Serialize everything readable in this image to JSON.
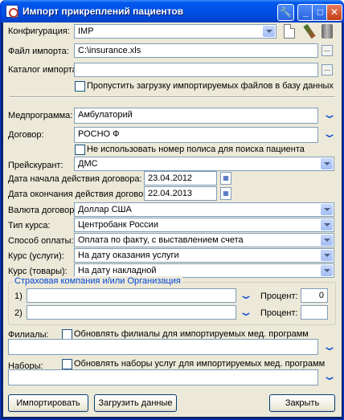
{
  "window": {
    "title": "Импорт прикреплений пациентов",
    "buttons": {
      "tools": "🔧",
      "minimize": "_",
      "maximize": "□",
      "close": "✕"
    }
  },
  "config": {
    "label": "Конфигурация:",
    "value": "IMP"
  },
  "import_file": {
    "label": "Файл импорта:",
    "value": "C:\\insurance.xls",
    "browse": "..."
  },
  "import_dir": {
    "label": "Каталог импорта:",
    "value": "",
    "browse": "..."
  },
  "skip_upload": {
    "label": "Пропустить загрузку импортируемых файлов в базу данных",
    "checked": false
  },
  "medprogram": {
    "label": "Медпрограмма:",
    "value": "Амбулаторий"
  },
  "contract": {
    "label": "Договор:",
    "value": "РОСНО Ф"
  },
  "no_policy": {
    "label": "Не использовать номер полиса для поиска пациента",
    "checked": false
  },
  "pricelist": {
    "label": "Прейскурант:",
    "value": "ДМС"
  },
  "start_date": {
    "label": "Дата начала действия договора:",
    "value": "23.04.2012"
  },
  "end_date": {
    "label": "Дата окончания действия договора:",
    "value": "22.04.2013"
  },
  "currency": {
    "label": "Валюта договора:",
    "value": "Доллар США"
  },
  "rate_type": {
    "label": "Тип курса:",
    "value": "Центробанк России"
  },
  "payment": {
    "label": "Способ оплаты:",
    "value": "Оплата по факту, с выставлением счета"
  },
  "rate_services": {
    "label": "Курс (услуги):",
    "value": "На дату оказания услуги"
  },
  "rate_goods": {
    "label": "Курс (товары):",
    "value": "На дату накладной"
  },
  "insurance": {
    "title": "Страховая компания и/или Организация",
    "rows": [
      {
        "num": "1)",
        "value": "",
        "percent_label": "Процент:",
        "percent": "0"
      },
      {
        "num": "2)",
        "value": "",
        "percent_label": "Процент:",
        "percent": ""
      }
    ]
  },
  "branches": {
    "label": "Филиалы:",
    "checkbox_label": "Обновлять филиалы для импортируемых мед. программ",
    "checked": false,
    "value": ""
  },
  "sets": {
    "label": "Наборы:",
    "checkbox_label": "Обновлять наборы услуг для импортируемых мед. программ",
    "checked": false,
    "value": ""
  },
  "footer": {
    "import": "Импортировать",
    "load": "Загрузить данные",
    "close": "Закрыть"
  }
}
